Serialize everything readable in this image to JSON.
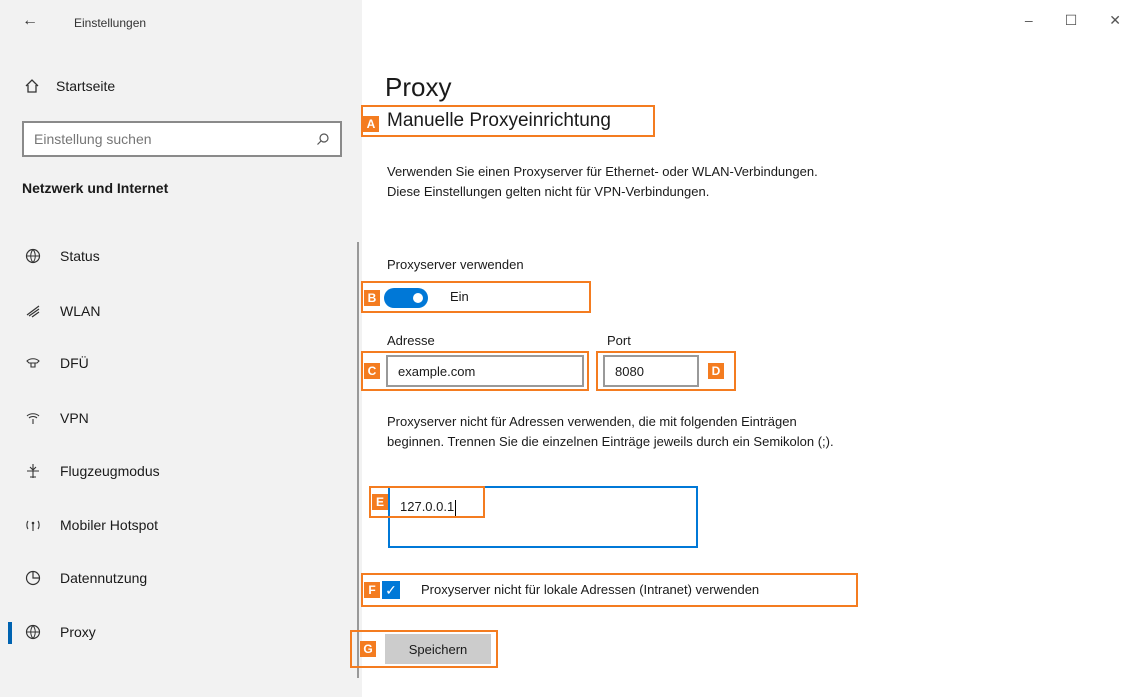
{
  "window": {
    "title": "Einstellungen",
    "back_icon": "back-arrow-icon",
    "controls": {
      "minimize": "–",
      "maximize": "☐",
      "close": "✕"
    }
  },
  "sidebar": {
    "home_label": "Startseite",
    "search_placeholder": "Einstellung suchen",
    "section_heading": "Netzwerk und Internet",
    "items": [
      {
        "label": "Status",
        "icon": "globe-status-icon"
      },
      {
        "label": "WLAN",
        "icon": "wifi-icon"
      },
      {
        "label": "DFÜ",
        "icon": "dialup-icon"
      },
      {
        "label": "VPN",
        "icon": "vpn-icon"
      },
      {
        "label": "Flugzeugmodus",
        "icon": "airplane-icon"
      },
      {
        "label": "Mobiler Hotspot",
        "icon": "hotspot-icon"
      },
      {
        "label": "Datennutzung",
        "icon": "data-usage-icon"
      },
      {
        "label": "Proxy",
        "icon": "globe-icon",
        "selected": true
      }
    ]
  },
  "main": {
    "page_title": "Proxy",
    "subheading": "Manuelle Proxyeinrichtung",
    "description": "Verwenden Sie einen Proxyserver für Ethernet- oder WLAN-Verbindungen. Diese Einstellungen gelten nicht für VPN-Verbindungen.",
    "use_proxy_label": "Proxyserver verwenden",
    "toggle_state_label": "Ein",
    "toggle_on": true,
    "address_label": "Adresse",
    "address_value": "example.com",
    "port_label": "Port",
    "port_value": "8080",
    "exceptions_description": "Proxyserver nicht für Adressen verwenden, die mit folgenden Einträgen beginnen. Trennen Sie die einzelnen Einträge jeweils durch ein Semikolon (;).",
    "exceptions_value": "127.0.0.1",
    "local_checkbox_label": "Proxyserver nicht für lokale Adressen (Intranet) verwenden",
    "local_checkbox_checked": true,
    "save_label": "Speichern"
  },
  "annotations": {
    "marker_color": "#f47c20",
    "labels": [
      "A",
      "B",
      "C",
      "D",
      "E",
      "F",
      "G"
    ]
  },
  "colors": {
    "accent": "#0078d7",
    "sidebar_bg": "#f2f2f2"
  }
}
